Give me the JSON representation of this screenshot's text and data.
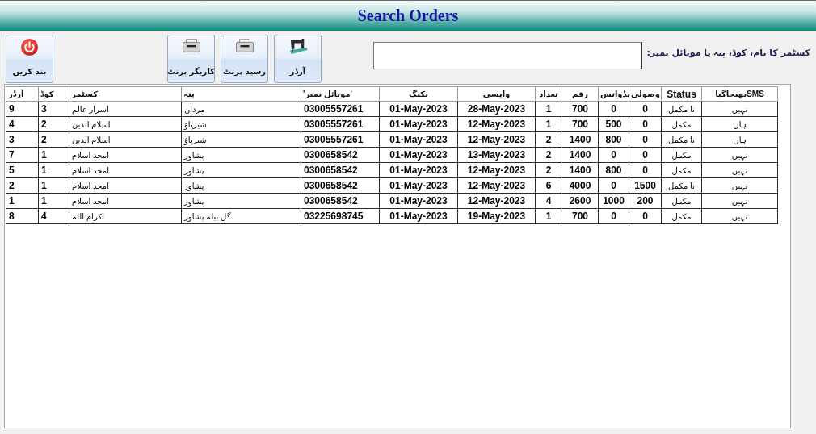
{
  "window": {
    "title": "Search Orders"
  },
  "search": {
    "label": "کسٹمر کا نام، کوڈ، پتہ یا موبائل نمبر:"
  },
  "toolbar": {
    "buttons": [
      {
        "kind": "order",
        "label": "آرڈر"
      },
      {
        "kind": "print",
        "label": "رسید پرنٹ"
      },
      {
        "kind": "print",
        "label": "کاریگر پرنٹ"
      },
      {
        "kind": "close",
        "label": "بند کریں"
      }
    ]
  },
  "table": {
    "columns": [
      "بھیجاگیاSMS",
      "Status",
      "وصولی",
      "یڈوانس",
      "رقم",
      "تعداد",
      "واپسی",
      "بکنگ",
      "'موبائل نمبر'",
      "پتہ",
      "کسٹمر",
      "کوڈ",
      "آرڈر"
    ],
    "rows": [
      [
        "نہیں",
        "نا مکمل",
        "0",
        "0",
        "700",
        "1",
        "28-May-2023",
        "01-May-2023",
        "03005557261",
        "مردان",
        "اسرار عالم",
        "3",
        "9"
      ],
      [
        "ہاں",
        "مکمل",
        "0",
        "500",
        "700",
        "1",
        "12-May-2023",
        "01-May-2023",
        "03005557261",
        "شیرپاؤ",
        "اسلام الدین",
        "2",
        "4"
      ],
      [
        "ہاں",
        "نا مکمل",
        "0",
        "800",
        "1400",
        "2",
        "12-May-2023",
        "01-May-2023",
        "03005557261",
        "شیرپاؤ",
        "اسلام الدین",
        "2",
        "3"
      ],
      [
        "نہیں",
        "مکمل",
        "0",
        "0",
        "1400",
        "2",
        "13-May-2023",
        "01-May-2023",
        "0300658542",
        "پشاور",
        "امجد اسلام",
        "1",
        "7"
      ],
      [
        "نہیں",
        "مکمل",
        "0",
        "800",
        "1400",
        "2",
        "12-May-2023",
        "01-May-2023",
        "0300658542",
        "پشاور",
        "امجد اسلام",
        "1",
        "5"
      ],
      [
        "نہیں",
        "نا مکمل",
        "1500",
        "0",
        "4000",
        "6",
        "12-May-2023",
        "01-May-2023",
        "0300658542",
        "پشاور",
        "امجد اسلام",
        "1",
        "2"
      ],
      [
        "نہیں",
        "مکمل",
        "200",
        "1000",
        "2600",
        "4",
        "12-May-2023",
        "01-May-2023",
        "0300658542",
        "پشاور",
        "امجد اسلام",
        "1",
        "1"
      ],
      [
        "نہیں",
        "مکمل",
        "0",
        "0",
        "700",
        "1",
        "19-May-2023",
        "01-May-2023",
        "03225698745",
        "گل بیلہ پشاور",
        "اکرام اللہ",
        "4",
        "8"
      ]
    ]
  }
}
